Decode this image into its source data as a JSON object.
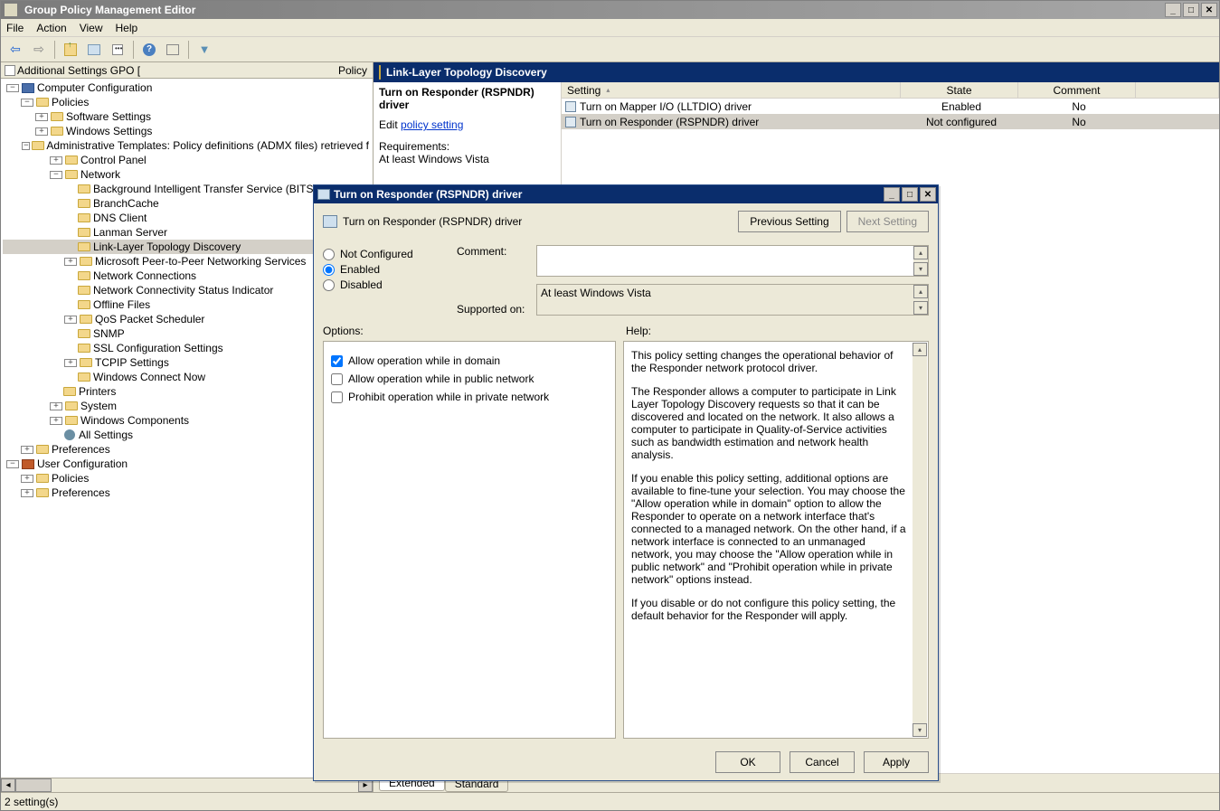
{
  "window": {
    "title": "Group Policy Management Editor"
  },
  "menu": {
    "file": "File",
    "action": "Action",
    "view": "View",
    "help": "Help"
  },
  "tree": {
    "header_left": "Additional Settings GPO [",
    "header_right": "Policy",
    "n_comp": "Computer Configuration",
    "n_policies": "Policies",
    "n_sw": "Software Settings",
    "n_ws": "Windows Settings",
    "n_at": "Administrative Templates: Policy definitions (ADMX files) retrieved f",
    "n_cp": "Control Panel",
    "n_network": "Network",
    "n_bits": "Background Intelligent Transfer Service (BITS)",
    "n_bc": "BranchCache",
    "n_dns": "DNS Client",
    "n_lanman": "Lanman Server",
    "n_lltd": "Link-Layer Topology Discovery",
    "n_p2p": "Microsoft Peer-to-Peer Networking Services",
    "n_nc": "Network Connections",
    "n_ncsi": "Network Connectivity Status Indicator",
    "n_off": "Offline Files",
    "n_qos": "QoS Packet Scheduler",
    "n_snmp": "SNMP",
    "n_ssl": "SSL Configuration Settings",
    "n_tcpip": "TCPIP Settings",
    "n_wcn": "Windows Connect Now",
    "n_printers": "Printers",
    "n_system": "System",
    "n_wc": "Windows Components",
    "n_alls": "All Settings",
    "n_prefs": "Preferences",
    "n_user": "User Configuration",
    "n_upol": "Policies",
    "n_uprefs": "Preferences"
  },
  "details": {
    "category": "Link-Layer Topology Discovery",
    "selected": "Turn on Responder (RSPNDR) driver",
    "edit_prefix": "Edit ",
    "edit_link": "policy setting",
    "req_label": "Requirements:",
    "req_value": "At least Windows Vista",
    "col_setting": "Setting",
    "col_state": "State",
    "col_comment": "Comment",
    "row1_setting": "Turn on Mapper I/O (LLTDIO) driver",
    "row1_state": "Enabled",
    "row1_comment": "No",
    "row2_setting": "Turn on Responder (RSPNDR) driver",
    "row2_state": "Not configured",
    "row2_comment": "No",
    "tab_ext": "Extended",
    "tab_std": "Standard"
  },
  "status": {
    "text": "2 setting(s)"
  },
  "dialog": {
    "title": "Turn on Responder (RSPNDR) driver",
    "policy_name": "Turn on Responder (RSPNDR) driver",
    "prev": "Previous Setting",
    "next": "Next Setting",
    "opt_nc": "Not Configured",
    "opt_en": "Enabled",
    "opt_dis": "Disabled",
    "lbl_comment": "Comment:",
    "lbl_supported": "Supported on:",
    "supported_val": "At least Windows Vista",
    "lbl_options": "Options:",
    "lbl_help": "Help:",
    "chk1": "Allow operation while in domain",
    "chk2": "Allow operation while in public network",
    "chk3": "Prohibit operation while in private network",
    "help1": "This policy setting changes the operational behavior of the Responder network protocol driver.",
    "help2": "The Responder allows a computer to participate in Link Layer Topology Discovery requests so that it can be discovered and located on the network. It also allows a computer to participate in Quality-of-Service activities such as bandwidth estimation and network health analysis.",
    "help3": "If you enable this policy setting, additional options are available to fine-tune your selection. You may choose the \"Allow operation while in domain\" option to allow the Responder to operate on a network interface that's connected to a managed network. On the other hand, if a network interface is connected to an unmanaged network, you may choose the \"Allow operation while in public network\" and \"Prohibit operation while in private network\" options instead.",
    "help4": "If you disable or do not configure this policy setting, the default behavior for the Responder will apply.",
    "btn_ok": "OK",
    "btn_cancel": "Cancel",
    "btn_apply": "Apply"
  }
}
